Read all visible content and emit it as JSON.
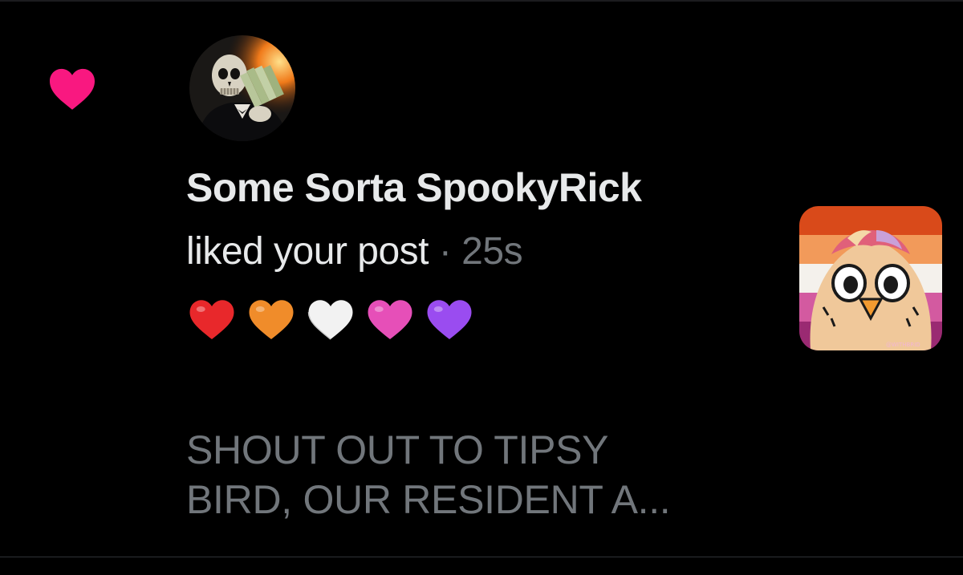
{
  "notification": {
    "type_icon": "heart-icon",
    "type_color": "#f91880",
    "actor_name": "Some Sorta SpookyRick",
    "action_text": "liked your post",
    "separator": "·",
    "timestamp": "25s",
    "post_emoji": [
      {
        "icon": "red-heart-emoji",
        "color": "#e8282b"
      },
      {
        "icon": "orange-heart-emoji",
        "color": "#f08c2a"
      },
      {
        "icon": "white-heart-emoji",
        "color": "#f2f2f2"
      },
      {
        "icon": "pink-heart-emoji",
        "color": "#e64fb8"
      },
      {
        "icon": "purple-heart-emoji",
        "color": "#9a4cf0"
      }
    ],
    "post_snippet_lines": [
      "SHOUT OUT TO TIPSY",
      "BIRD, OUR RESIDENT A..."
    ],
    "thumbnail_watermark": "@WITHBRID"
  }
}
